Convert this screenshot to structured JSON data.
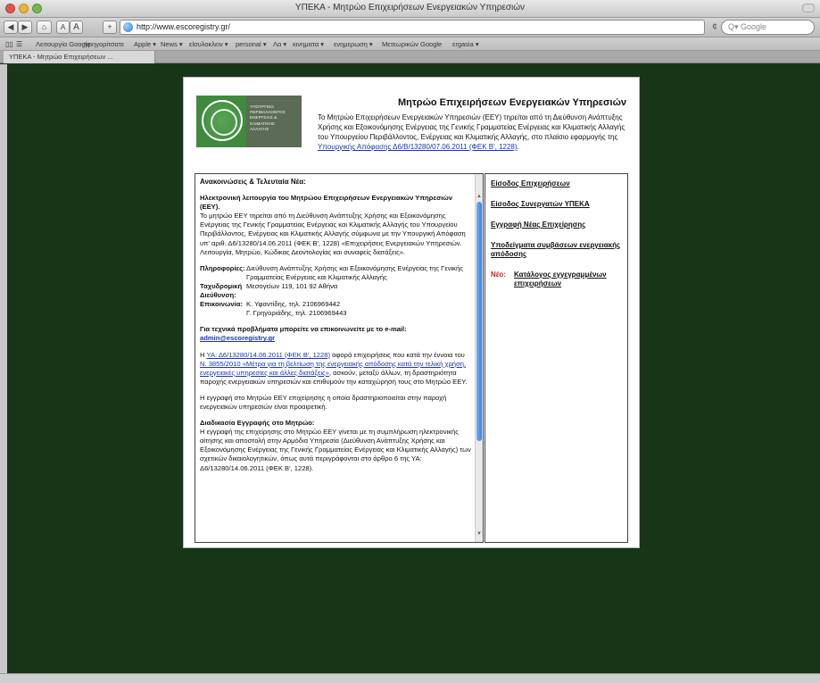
{
  "window": {
    "title": "ΥΠΕΚΑ - Μητρώο Επιχειρήσεων Ενεργειακών Υπηρεσιών"
  },
  "toolbar": {
    "back": "◀",
    "forward": "▶",
    "home": "⌂",
    "text_smaller": "A",
    "text_bigger": "A",
    "add_bookmark": "+",
    "url": "http://www.escoregistry.gr/",
    "reload": "¢",
    "search_placeholder": "Q▾ Google"
  },
  "bookmarks": [
    "Λειτουργία Google",
    "γρηγορίτσατε",
    "Apple ▾",
    "News ▾",
    "εlσυλοκλειν ▾",
    "personal ▾",
    "Λα ▾",
    "κινηματα ▾",
    "ενημερωση ▾",
    "Μετεωρικών Google",
    "εrgasia ▾"
  ],
  "tab": {
    "label": "ΥΠΕΚΑ - Μητρώο Επιχειρήσεων ..."
  },
  "header": {
    "logo_text": "ΥΠΟΥΡΓΕΙΟ\nΠΕΡΙΒΑΛΛΟΝΤΟΣ\nΕΝΕΡΓΕΙΑΣ &\nΚΛΙΜΑΤΙΚΗΣ\nΑΛΛΑΓΗΣ",
    "title": "Μητρώο Επιχειρήσεων Ενεργειακών Υπηρεσιών",
    "intro": "Το Μητρώο Επιχειρήσεων Ενεργειακών Υπηρεσιών (ΕΕΥ) τηρείται από τη Διεύθυνση Ανάπτυξης Χρήσης και Εξοικονόμησης Ενέργειας της Γενικής Γραμματείας Ενέργειας και Κλιματικής Αλλαγής του Υπουργείου Περιβάλλοντος, Ενέργειας και Κλιματικής Αλλαγής, στο πλαίσιο εφαρμογής της",
    "intro_link": "Υπουργικής Απόφασης Δ6/Β/13280/07.06.2011 (ΦΕΚ Β', 1228)",
    "intro_end": "."
  },
  "left": {
    "section_title": "Ανακοινώσεις & Τελευταία Νέα:",
    "news_title": "Ηλεκτρονική λειτουργία του Μητρώου Επιχειρήσεων Ενεργειακών Υπηρεσιών (ΕΕΥ).",
    "news_body": "Το μητρώο ΕΕΥ τηρείται από τη Διεύθυνση Ανάπτυξης Χρήσης και Εξοικονόμησης Ενέργειας της Γενικής Γραμματείας Ενέργειας και Κλιματικής Αλλαγής του Υπουργείου Περιβάλλοντος, Ενέργειας και Κλιματικής Αλλαγής σύμφωνα με την Υπουργική Απόφαση υπ' αριθ. Δ6/13280/14.06.2011 (ΦΕΚ Β', 1228) «Επιχειρήσεις Ενεργειακών Υπηρεσιών. Λειτουργία, Μητρώο, Κώδικας Δεοντολογίας και συναφείς διατάξεις».",
    "info_label": "Πληροφορίες:",
    "info_value": "Διεύθυνση Ανάπτυξης Χρήσης και Εξοικονόμησης Ενέργειας της Γενικής Γραμματείας Ενέργειας και Κλιματικής Αλλαγής",
    "address_label": "Ταχυδρομική Διεύθυνση:",
    "address_value": "Μεσογείων 119, 101 92 Αθήνα",
    "contact_label": "Επικοινωνία:",
    "contact_1": "Κ. Υφαντίδης, τηλ. 2106969442",
    "contact_2": "Γ. Γρηγοριάδης, τηλ. 2106969443",
    "tech_title": "Για τεχνικά προβλήματα μπορείτε να επικοινωνείτε με το e-mail:",
    "tech_email": "admin@escoregistry.gr",
    "para1_a": "Η",
    "para1_link1": "ΥΑ: Δ6/13280/14.06.2011 (ΦΕΚ Β', 1228)",
    "para1_b": "αφορά επιχειρήσεις που κατά την έννοια του",
    "para1_link2": "Ν. 3855/2010 «Μέτρα για τη βελτίωση της ενεργειακής απόδοσης κατά την τελική χρήση, ενεργειακές υπηρεσίες και άλλες διατάξεις»",
    "para1_c": ", ασκούν, μεταξύ άλλων, τη δραστηριότητα παροχής ενεργειακών υπηρεσιών και επιθυμούν την καταχώρησή τους στο Μητρώο ΕΕΥ.",
    "para2": "Η εγγραφή στο Μητρώο ΕΕΥ επιχείρησης η οποία δραστηριοποιείται στην παροχή ενεργειακών υπηρεσιών είναι προαιρετική.",
    "proc_title": "Διαδικασία Εγγραφής στο Μητρώο:",
    "proc_body": "Η εγγραφή της επιχείρησης στο Μητρώο ΕΕΥ γίνεται με τη συμπλήρωση ηλεκτρονικής αίτησης και αποστολή στην Αρμόδια Υπηρεσία (Διεύθυνση Ανάπτυξης Χρήσης και Εξοικονόμησης Ενέργειας της Γενικής Γραμματείας Ενέργειας και Κλιματικής Αλλαγής) των σχετικών δικαιολογητικών, όπως αυτά περιγράφονται στο άρθρο 6 της ΥΑ: Δ6/13280/14.06.2011 (ΦΕΚ Β', 1228)."
  },
  "right": {
    "links": [
      "Είσοδος Επιχειρήσεων",
      "Είσοδος Συνεργατών ΥΠΕΚΑ",
      "Εγγραφή Νέας Επιχείρησης",
      "Υποδείγματα συμβάσεων ενεργειακής απόδοσης"
    ],
    "new_label": "Νέο:",
    "new_link": "Κατάλογος εγγεγραμμένων επιχειρήσεων"
  },
  "colors": {
    "page_background": "#173517",
    "logo_green": "#3f8a3e",
    "link_blue": "#1a35b9",
    "new_red": "#d21c1c"
  }
}
